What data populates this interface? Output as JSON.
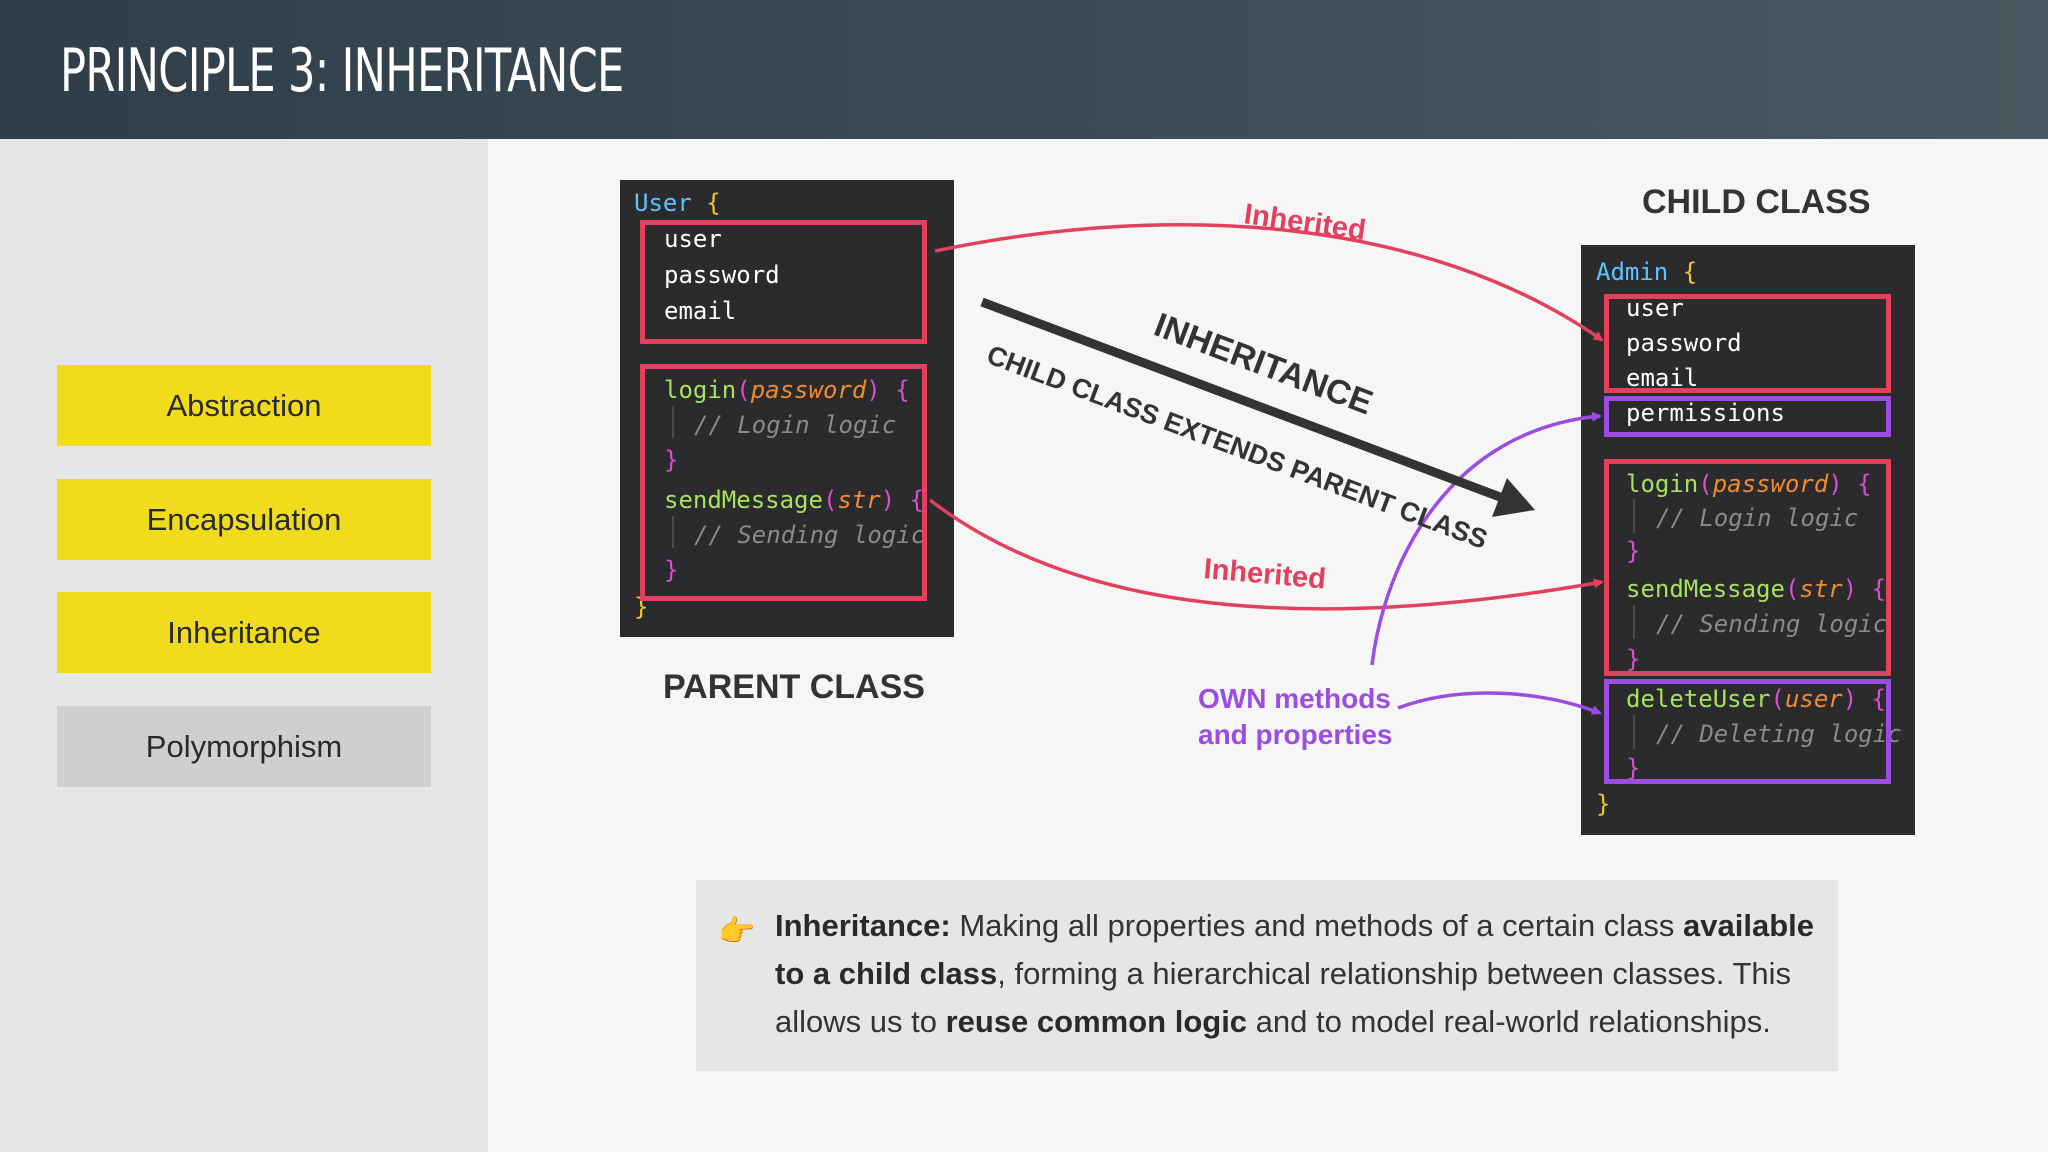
{
  "header": {
    "title": "PRINCIPLE 3: INHERITANCE"
  },
  "sidebar": {
    "items": [
      {
        "label": "Abstraction",
        "state": "highlighted"
      },
      {
        "label": "Encapsulation",
        "state": "highlighted"
      },
      {
        "label": "Inheritance",
        "state": "highlighted"
      },
      {
        "label": "Polymorphism",
        "state": "inactive"
      }
    ]
  },
  "parent": {
    "heading": "PARENT CLASS",
    "class_name": "User",
    "open_brace": "{",
    "close_brace": "}",
    "properties": [
      "user",
      "password",
      "email"
    ],
    "methods": [
      {
        "name": "login",
        "param": "password",
        "comment": "// Login logic"
      },
      {
        "name": "sendMessage",
        "param": "str",
        "comment": "// Sending logic"
      }
    ]
  },
  "child": {
    "heading": "CHILD CLASS",
    "class_name": "Admin",
    "open_brace": "{",
    "close_brace": "}",
    "properties": [
      "user",
      "password",
      "email"
    ],
    "own_property": "permissions",
    "methods": [
      {
        "name": "login",
        "param": "password",
        "comment": "// Login logic"
      },
      {
        "name": "sendMessage",
        "param": "str",
        "comment": "// Sending logic"
      }
    ],
    "own_method": {
      "name": "deleteUser",
      "param": "user",
      "comment": "// Deleting logic"
    }
  },
  "arrows": {
    "inherited_top": "Inherited",
    "inherited_bottom": "Inherited",
    "inheritance_title": "INHERITANCE",
    "inheritance_subtitle": "CHILD CLASS EXTENDS PARENT CLASS",
    "own_line1": "OWN methods",
    "own_line2": "and properties"
  },
  "colors": {
    "inherited": "#e3405e",
    "own": "#9b4de3",
    "highlight": "#f1db1d",
    "code_bg": "#2b2a2c"
  },
  "info": {
    "pointer_icon": "pointing-hand-icon",
    "pointer_glyph": "👉",
    "term": "Inheritance:",
    "text1": " Making all properties and methods of a certain class ",
    "bold1": "available to a child class",
    "text2": ", forming a hierarchical relationship between classes. This allows us to ",
    "bold2": "reuse common logic",
    "text3": " and to model real-world relationships."
  }
}
